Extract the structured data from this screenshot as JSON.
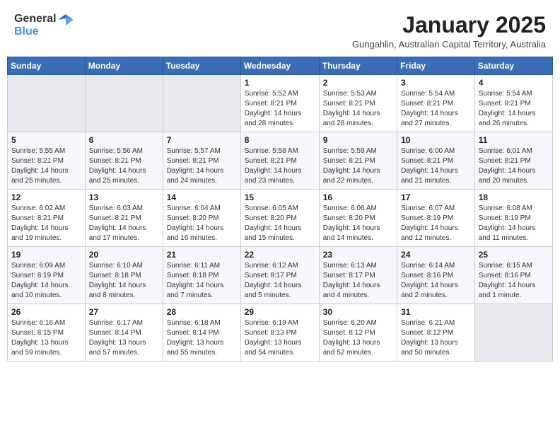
{
  "header": {
    "logo_general": "General",
    "logo_blue": "Blue",
    "month_title": "January 2025",
    "subtitle": "Gungahlin, Australian Capital Territory, Australia"
  },
  "days_of_week": [
    "Sunday",
    "Monday",
    "Tuesday",
    "Wednesday",
    "Thursday",
    "Friday",
    "Saturday"
  ],
  "weeks": [
    [
      {
        "day": "",
        "info": "",
        "empty": true
      },
      {
        "day": "",
        "info": "",
        "empty": true
      },
      {
        "day": "",
        "info": "",
        "empty": true
      },
      {
        "day": "1",
        "info": "Sunrise: 5:52 AM\nSunset: 8:21 PM\nDaylight: 14 hours\nand 28 minutes."
      },
      {
        "day": "2",
        "info": "Sunrise: 5:53 AM\nSunset: 8:21 PM\nDaylight: 14 hours\nand 28 minutes."
      },
      {
        "day": "3",
        "info": "Sunrise: 5:54 AM\nSunset: 8:21 PM\nDaylight: 14 hours\nand 27 minutes."
      },
      {
        "day": "4",
        "info": "Sunrise: 5:54 AM\nSunset: 8:21 PM\nDaylight: 14 hours\nand 26 minutes."
      }
    ],
    [
      {
        "day": "5",
        "info": "Sunrise: 5:55 AM\nSunset: 8:21 PM\nDaylight: 14 hours\nand 25 minutes."
      },
      {
        "day": "6",
        "info": "Sunrise: 5:56 AM\nSunset: 8:21 PM\nDaylight: 14 hours\nand 25 minutes."
      },
      {
        "day": "7",
        "info": "Sunrise: 5:57 AM\nSunset: 8:21 PM\nDaylight: 14 hours\nand 24 minutes."
      },
      {
        "day": "8",
        "info": "Sunrise: 5:58 AM\nSunset: 8:21 PM\nDaylight: 14 hours\nand 23 minutes."
      },
      {
        "day": "9",
        "info": "Sunrise: 5:59 AM\nSunset: 8:21 PM\nDaylight: 14 hours\nand 22 minutes."
      },
      {
        "day": "10",
        "info": "Sunrise: 6:00 AM\nSunset: 8:21 PM\nDaylight: 14 hours\nand 21 minutes."
      },
      {
        "day": "11",
        "info": "Sunrise: 6:01 AM\nSunset: 8:21 PM\nDaylight: 14 hours\nand 20 minutes."
      }
    ],
    [
      {
        "day": "12",
        "info": "Sunrise: 6:02 AM\nSunset: 8:21 PM\nDaylight: 14 hours\nand 19 minutes."
      },
      {
        "day": "13",
        "info": "Sunrise: 6:03 AM\nSunset: 8:21 PM\nDaylight: 14 hours\nand 17 minutes."
      },
      {
        "day": "14",
        "info": "Sunrise: 6:04 AM\nSunset: 8:20 PM\nDaylight: 14 hours\nand 16 minutes."
      },
      {
        "day": "15",
        "info": "Sunrise: 6:05 AM\nSunset: 8:20 PM\nDaylight: 14 hours\nand 15 minutes."
      },
      {
        "day": "16",
        "info": "Sunrise: 6:06 AM\nSunset: 8:20 PM\nDaylight: 14 hours\nand 14 minutes."
      },
      {
        "day": "17",
        "info": "Sunrise: 6:07 AM\nSunset: 8:19 PM\nDaylight: 14 hours\nand 12 minutes."
      },
      {
        "day": "18",
        "info": "Sunrise: 6:08 AM\nSunset: 8:19 PM\nDaylight: 14 hours\nand 11 minutes."
      }
    ],
    [
      {
        "day": "19",
        "info": "Sunrise: 6:09 AM\nSunset: 8:19 PM\nDaylight: 14 hours\nand 10 minutes."
      },
      {
        "day": "20",
        "info": "Sunrise: 6:10 AM\nSunset: 8:18 PM\nDaylight: 14 hours\nand 8 minutes."
      },
      {
        "day": "21",
        "info": "Sunrise: 6:11 AM\nSunset: 8:18 PM\nDaylight: 14 hours\nand 7 minutes."
      },
      {
        "day": "22",
        "info": "Sunrise: 6:12 AM\nSunset: 8:17 PM\nDaylight: 14 hours\nand 5 minutes."
      },
      {
        "day": "23",
        "info": "Sunrise: 6:13 AM\nSunset: 8:17 PM\nDaylight: 14 hours\nand 4 minutes."
      },
      {
        "day": "24",
        "info": "Sunrise: 6:14 AM\nSunset: 8:16 PM\nDaylight: 14 hours\nand 2 minutes."
      },
      {
        "day": "25",
        "info": "Sunrise: 6:15 AM\nSunset: 8:16 PM\nDaylight: 14 hours\nand 1 minute."
      }
    ],
    [
      {
        "day": "26",
        "info": "Sunrise: 6:16 AM\nSunset: 8:15 PM\nDaylight: 13 hours\nand 59 minutes."
      },
      {
        "day": "27",
        "info": "Sunrise: 6:17 AM\nSunset: 8:14 PM\nDaylight: 13 hours\nand 57 minutes."
      },
      {
        "day": "28",
        "info": "Sunrise: 6:18 AM\nSunset: 8:14 PM\nDaylight: 13 hours\nand 55 minutes."
      },
      {
        "day": "29",
        "info": "Sunrise: 6:19 AM\nSunset: 8:13 PM\nDaylight: 13 hours\nand 54 minutes."
      },
      {
        "day": "30",
        "info": "Sunrise: 6:20 AM\nSunset: 8:12 PM\nDaylight: 13 hours\nand 52 minutes."
      },
      {
        "day": "31",
        "info": "Sunrise: 6:21 AM\nSunset: 8:12 PM\nDaylight: 13 hours\nand 50 minutes."
      },
      {
        "day": "",
        "info": "",
        "empty": true
      }
    ]
  ]
}
